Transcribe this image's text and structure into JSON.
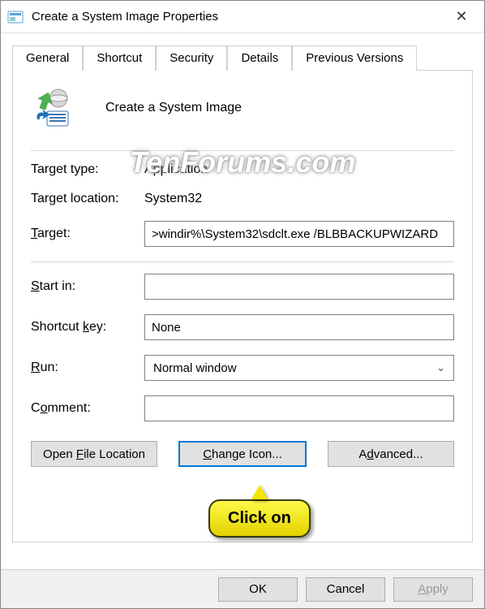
{
  "titlebar": {
    "title": "Create a System Image Properties",
    "close": "✕"
  },
  "tabs": {
    "items": [
      {
        "label": "General"
      },
      {
        "label": "Shortcut"
      },
      {
        "label": "Security"
      },
      {
        "label": "Details"
      },
      {
        "label": "Previous Versions"
      }
    ],
    "activeIndex": 1
  },
  "shortcut": {
    "name": "Create a System Image",
    "target_type_label": "Target type:",
    "target_type_value": "Application",
    "target_location_label": "Target location:",
    "target_location_value": "System32",
    "target_label_pre": "",
    "target_label_u": "T",
    "target_label_post": "arget:",
    "target_value": ">windir%\\System32\\sdclt.exe /BLBBACKUPWIZARD",
    "start_in_label_pre": "",
    "start_in_label_u": "S",
    "start_in_label_post": "tart in:",
    "start_in_value": "",
    "shortcut_key_label_pre": "Shortcut ",
    "shortcut_key_label_u": "k",
    "shortcut_key_label_post": "ey:",
    "shortcut_key_value": "None",
    "run_label_pre": "",
    "run_label_u": "R",
    "run_label_post": "un:",
    "run_value": "Normal window",
    "comment_label_pre": "C",
    "comment_label_u": "o",
    "comment_label_post": "mment:",
    "comment_value": ""
  },
  "buttons": {
    "open_file_pre": "Open ",
    "open_file_u": "F",
    "open_file_post": "ile Location",
    "change_icon_pre": "",
    "change_icon_u": "C",
    "change_icon_post": "hange Icon...",
    "advanced_pre": "A",
    "advanced_u": "d",
    "advanced_post": "vanced..."
  },
  "bottom": {
    "ok": "OK",
    "cancel": "Cancel",
    "apply_u": "A",
    "apply_post": "pply"
  },
  "watermark": "TenForums.com",
  "callout": "Click on"
}
